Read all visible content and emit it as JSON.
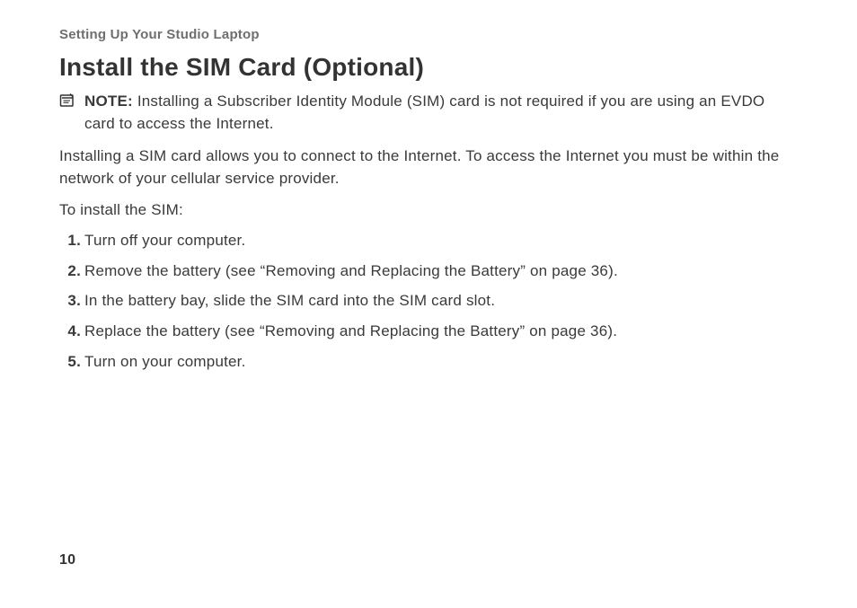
{
  "breadcrumb": "Setting Up Your Studio Laptop",
  "title": "Install the SIM Card (Optional)",
  "note": {
    "label": "NOTE:",
    "text": "Installing a Subscriber Identity Module (SIM) card is not required if you are using an EVDO card to access the Internet."
  },
  "paragraph1": "Installing a SIM card allows you to connect to the Internet. To access the Internet you must be within the network of your cellular service provider.",
  "paragraph2": "To install the SIM:",
  "steps": [
    "Turn off your computer.",
    "Remove the battery (see “Removing and Replacing the Battery” on page 36).",
    "In the battery bay, slide the SIM card into the SIM card slot.",
    "Replace the battery (see “Removing and Replacing the Battery” on page 36).",
    "Turn on your computer."
  ],
  "page_number": "10"
}
